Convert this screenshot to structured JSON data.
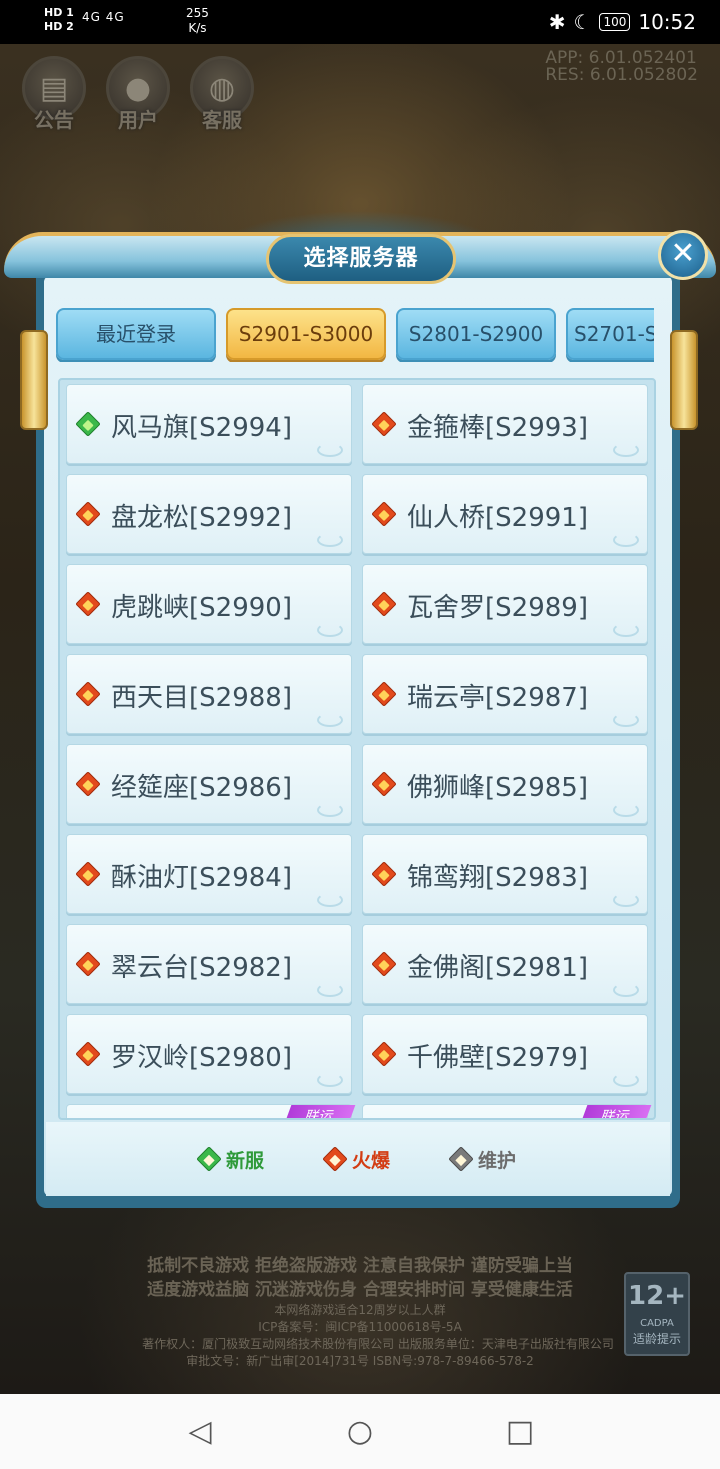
{
  "status_bar": {
    "sim1": "HD 1",
    "sim2": "HD 2",
    "network": "4G  4G",
    "speed_value": "255",
    "speed_unit": "K/s",
    "battery": "100",
    "time": "10:52"
  },
  "version": {
    "app": "APP: 6.01.052401",
    "res": "RES: 6.01.052802"
  },
  "top_buttons": [
    {
      "label": "公告",
      "icon": "notice-icon"
    },
    {
      "label": "用户",
      "icon": "user-icon"
    },
    {
      "label": "客服",
      "icon": "headset-icon"
    }
  ],
  "panel": {
    "title": "选择服务器",
    "close_label": "✕"
  },
  "tabs": [
    {
      "label": "最近登录",
      "active": false
    },
    {
      "label": "S2901-S3000",
      "active": true
    },
    {
      "label": "S2801-S2900",
      "active": false
    },
    {
      "label": "S2701-S",
      "active": false
    }
  ],
  "servers": [
    {
      "name": "风马旗[S2994]",
      "status": "new"
    },
    {
      "name": "金箍棒[S2993]",
      "status": "hot"
    },
    {
      "name": "盘龙松[S2992]",
      "status": "hot"
    },
    {
      "name": "仙人桥[S2991]",
      "status": "hot"
    },
    {
      "name": "虎跳峡[S2990]",
      "status": "hot"
    },
    {
      "name": "瓦舍罗[S2989]",
      "status": "hot"
    },
    {
      "name": "西天目[S2988]",
      "status": "hot"
    },
    {
      "name": "瑞云亭[S2987]",
      "status": "hot"
    },
    {
      "name": "经筵座[S2986]",
      "status": "hot"
    },
    {
      "name": "佛狮峰[S2985]",
      "status": "hot"
    },
    {
      "name": "酥油灯[S2984]",
      "status": "hot"
    },
    {
      "name": "锦鸾翔[S2983]",
      "status": "hot"
    },
    {
      "name": "翠云台[S2982]",
      "status": "hot"
    },
    {
      "name": "金佛阁[S2981]",
      "status": "hot"
    },
    {
      "name": "罗汉岭[S2980]",
      "status": "hot"
    },
    {
      "name": "千佛壁[S2979]",
      "status": "hot"
    }
  ],
  "ribbon_text": "联运",
  "legend": {
    "new": "新服",
    "hot": "火爆",
    "maint": "维护"
  },
  "colors": {
    "new": "#3bb84a",
    "hot": "#e24a1c",
    "maint": "#7a7a7a",
    "active_tab": "#f2b743"
  },
  "footer": {
    "line1": "抵制不良游戏 拒绝盗版游戏 注意自我保护 谨防受骗上当",
    "line2": "适度游戏益脑 沉迷游戏伤身 合理安排时间 享受健康生活",
    "line3": "本网络游戏适合12周岁以上人群",
    "line4": "ICP备案号：闽ICP备11000618号-5A",
    "line5": "著作权人：厦门极致互动网络技术股份有限公司 出版服务单位：天津电子出版社有限公司",
    "line6": "审批文号：新广出审[2014]731号   ISBN号:978-7-89466-578-2"
  },
  "age_badge": {
    "rating": "12+",
    "org": "CADPA",
    "tip": "适龄提示"
  },
  "nav": {
    "back": "◁",
    "home": "○",
    "recent": "□"
  }
}
